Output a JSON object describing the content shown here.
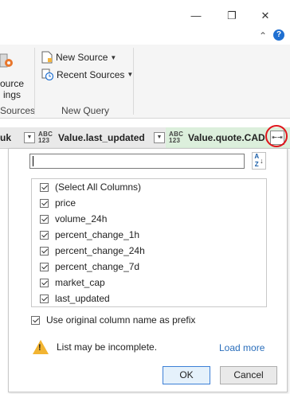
{
  "window": {
    "minimize_glyph": "—",
    "restore_glyph": "❐",
    "close_glyph": "✕",
    "collapse_glyph": "⌃",
    "help_glyph": "?"
  },
  "ribbon": {
    "datasource_line1": "ource",
    "datasource_line2": "ings",
    "sources_group": "Sources",
    "new_source": "New Source",
    "recent_sources": "Recent Sources",
    "new_query_group": "New Query"
  },
  "column_bar": {
    "left_fragment": "uk",
    "type_top": "ABC",
    "type_bottom": "123",
    "col1": "Value.last_updated",
    "col2": "Value.quote.CAD",
    "expand_glyph": "⇤⇥"
  },
  "popup": {
    "search_value": "",
    "sort_top": "A",
    "sort_bottom": "Z",
    "items": [
      "(Select All Columns)",
      "price",
      "volume_24h",
      "percent_change_1h",
      "percent_change_24h",
      "percent_change_7d",
      "market_cap",
      "last_updated"
    ],
    "prefix_label": "Use original column name as prefix",
    "warning_text": "List may be incomplete.",
    "load_more": "Load more",
    "ok": "OK",
    "cancel": "Cancel"
  },
  "colors": {
    "accent": "#2a6ebb",
    "highlight": "#e0141b",
    "column_green": "#dcefdc",
    "warning": "#f2b431"
  }
}
